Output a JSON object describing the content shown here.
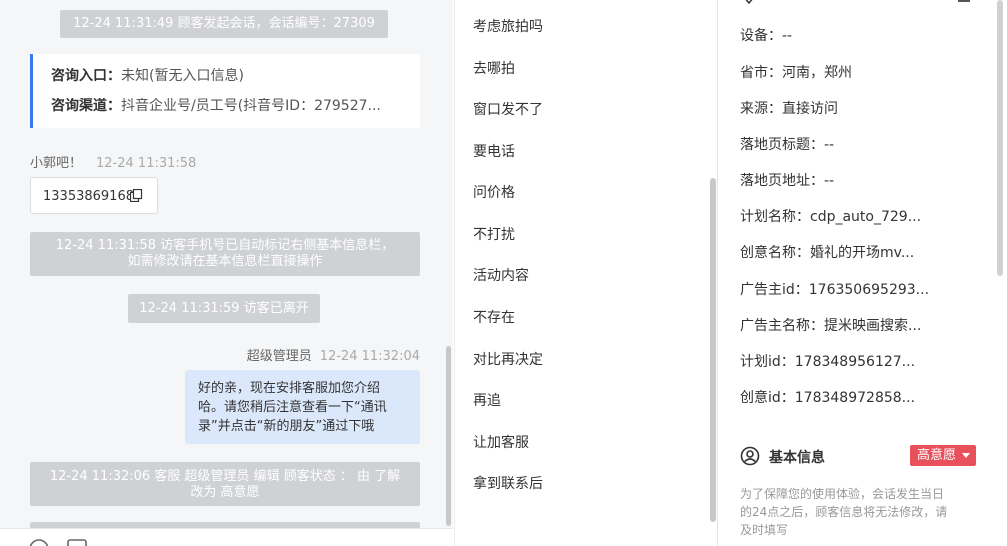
{
  "chat": {
    "session_start": "12-24 11:31:49 顾客发起会话，会话编号：27309",
    "entry_label": "咨询入口：",
    "entry_value": "未知(暂无入口信息)",
    "channel_label": "咨询渠道：",
    "channel_value": "抖音企业号/员工号(抖音号ID：279527...",
    "visitor_name": "小郭吧！",
    "visitor_time": "12-24 11:31:58",
    "visitor_phone": "13353869168",
    "phone_notice_line1": "12-24 11:31:58 访客手机号已自动标记右侧基本信息栏，",
    "phone_notice_line2": "如需修改请在基本信息栏直接操作",
    "left_notice": "12-24 11:31:59 访客已离开",
    "agent_name": "超级管理员",
    "agent_time": "12-24 11:32:04",
    "agent_msg_line1": "好的亲，现在安排客服加您介绍",
    "agent_msg_line2": "哈。请您稍后注意查看一下“通讯",
    "agent_msg_line3": "录”并点击“新的朋友”通过下哦",
    "status_change_line1": "12-24 11:32:06 客服 超级管理员 编辑 顾客状态 ： 由 了解",
    "status_change_line2": "改为 高意愿"
  },
  "replies": [
    "考虑旅拍吗",
    "去哪拍",
    "窗口发不了",
    "要电话",
    "问价格",
    "不打扰",
    "活动内容",
    "不存在",
    "对比再决定",
    "再追",
    "让加客服",
    "拿到联系后"
  ],
  "info": {
    "rows": [
      "设备：--",
      "省市：河南，郑州",
      "来源：直接访问",
      "落地页标题：--",
      "落地页地址：--",
      "计划名称：cdp_auto_729...",
      "创意名称：婚礼的开场mv...",
      "广告主id：176350695293...",
      "广告主名称：提米映画搜索...",
      "计划id：178348956127...",
      "创意id：178348972858..."
    ],
    "basic_title": "基本信息",
    "intent_tag": "高意愿",
    "notice_line1": "为了保障您的使用体验，会话发生当日",
    "notice_line2": "的24点之后，顾客信息将无法修改，请",
    "notice_line3": "及时填写"
  },
  "colors": {
    "accent": "#3a7bf2",
    "agent_bubble": "#dbe8fb",
    "system_pill": "#cfd1d4",
    "intent_tag": "#e8505b"
  }
}
